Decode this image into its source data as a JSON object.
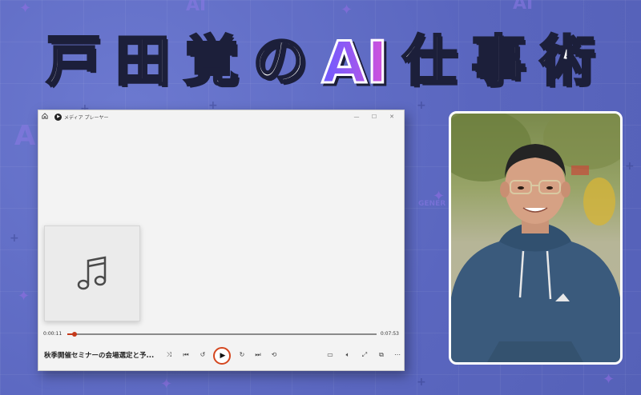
{
  "headline": {
    "part1": [
      "戸",
      "田",
      "覚",
      "の"
    ],
    "ai": "AI",
    "part2": [
      "仕",
      "事",
      "術"
    ]
  },
  "background_text": {
    "ai_mark": "AI",
    "gener_mark": "GENER"
  },
  "player": {
    "title": "メディア プレーヤー",
    "current_time": "0:00:11",
    "total_time": "0:07:53",
    "progress_fraction": 0.023,
    "track_title": "秋季開催セミナーの会場選定と予...",
    "icons": {
      "home": "home-icon",
      "shuffle": "shuffle-icon",
      "previous": "previous-icon",
      "rewind": "rewind-10-icon",
      "play": "play-icon",
      "forward": "forward-30-icon",
      "next": "next-icon",
      "repeat": "repeat-icon",
      "miniplayer": "miniplayer-icon",
      "volume": "volume-icon",
      "fullscreen": "fullscreen-icon",
      "cast": "cast-icon",
      "more": "more-icon"
    }
  },
  "colors": {
    "background": "#5d6bc2",
    "accent": "#c4391a",
    "ai_gradient_start": "#6e5bff",
    "ai_gradient_end": "#d84fd9"
  }
}
